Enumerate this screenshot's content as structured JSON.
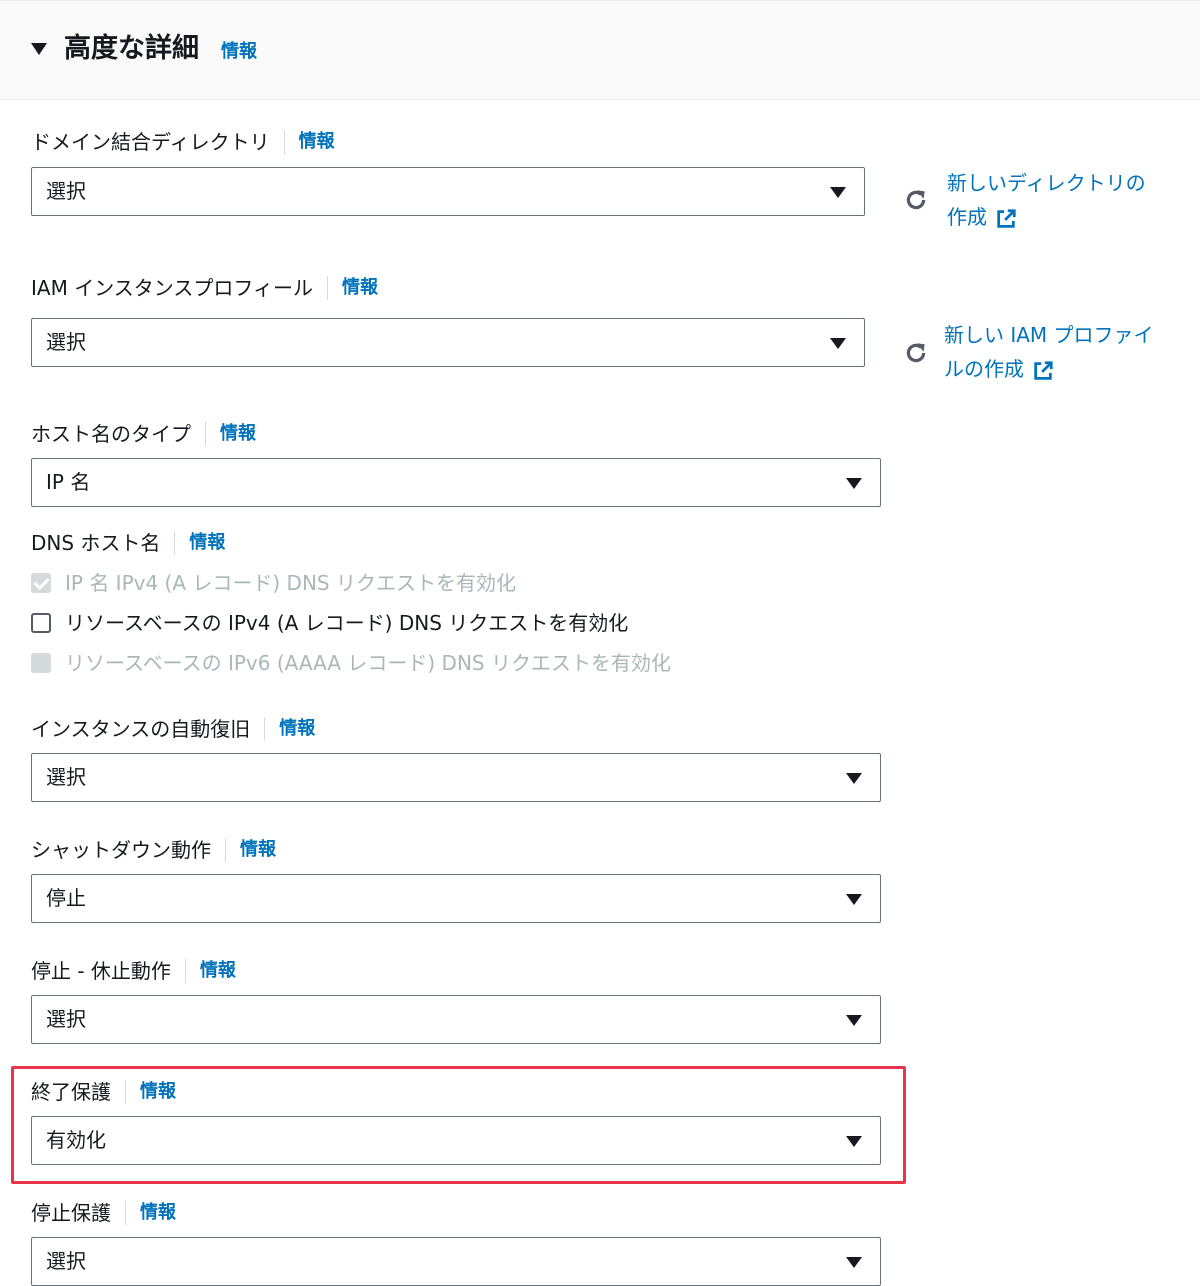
{
  "section": {
    "title": "高度な詳細",
    "info": "情報"
  },
  "fields": {
    "domain": {
      "label": "ドメイン結合ディレクトリ",
      "info": "情報",
      "value": "選択"
    },
    "iam": {
      "label": "IAM インスタンスプロフィール",
      "info": "情報",
      "value": "選択"
    },
    "hostname_type": {
      "label": "ホスト名のタイプ",
      "info": "情報",
      "value": "IP 名"
    },
    "dns_hostname": {
      "label": "DNS ホスト名",
      "info": "情報"
    },
    "recovery": {
      "label": "インスタンスの自動復旧",
      "info": "情報",
      "value": "選択"
    },
    "shutdown": {
      "label": "シャットダウン動作",
      "info": "情報",
      "value": "停止"
    },
    "stop_hibernate": {
      "label": "停止 - 休止動作",
      "info": "情報",
      "value": "選択"
    },
    "termination": {
      "label": "終了保護",
      "info": "情報",
      "value": "有効化"
    },
    "stop_protection": {
      "label": "停止保護",
      "info": "情報",
      "value": "選択"
    }
  },
  "side_links": {
    "new_directory": {
      "line1": "新しいディレクトリの",
      "line2": "作成"
    },
    "new_iam": {
      "line1": "新しい IAM プロファイ",
      "line2": "ルの作成"
    }
  },
  "checkboxes": [
    {
      "label": "IP 名 IPv4 (A レコード) DNS リクエストを有効化",
      "checked": true,
      "disabled": true
    },
    {
      "label": "リソースベースの IPv4 (A レコード) DNS リクエストを有効化",
      "checked": false,
      "disabled": false
    },
    {
      "label": "リソースベースの IPv6 (AAAA レコード) DNS リクエストを有効化",
      "checked": false,
      "disabled": true
    }
  ],
  "colors": {
    "link": "#0073bb",
    "highlight": "#e8344a",
    "disabled": "#aab7b8"
  },
  "icons": {
    "refresh": "refresh-icon",
    "external": "external-link-icon",
    "expand": "caret-down-icon"
  }
}
